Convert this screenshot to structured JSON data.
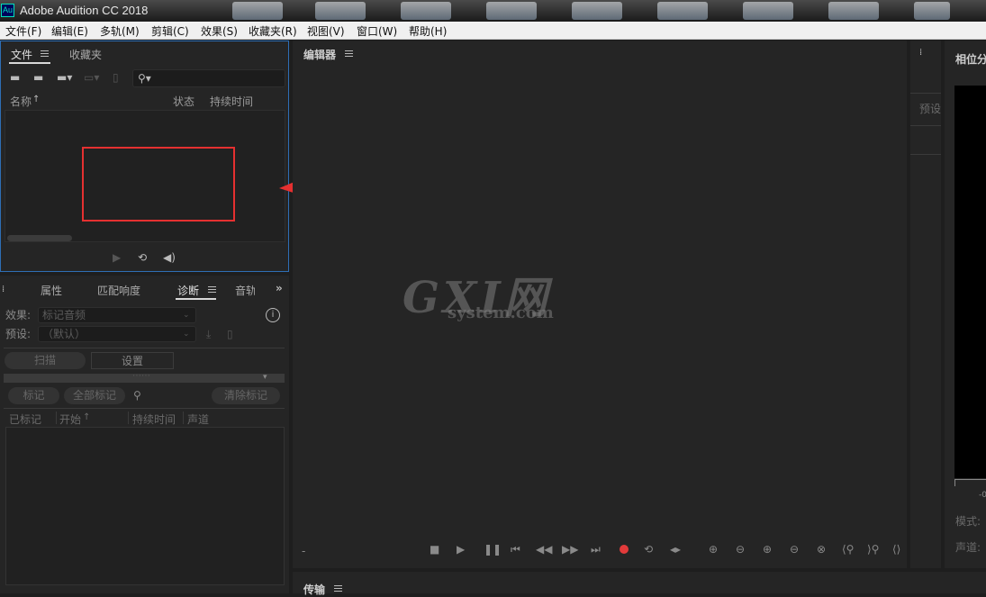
{
  "titlebar": {
    "app_icon": "Au",
    "title": "Adobe Audition CC 2018"
  },
  "menu": [
    "文件(F)",
    "编辑(E)",
    "多轨(M)",
    "剪辑(C)",
    "效果(S)",
    "收藏夹(R)",
    "视图(V)",
    "窗口(W)",
    "帮助(H)"
  ],
  "files_panel": {
    "tabs": [
      "文件",
      "收藏夹"
    ],
    "search_placeholder": "",
    "columns": [
      "名称",
      "状态",
      "持续时间"
    ],
    "sort_icon": "arrow-up-icon",
    "items": []
  },
  "diag_panel": {
    "tabs": [
      "属性",
      "匹配响度",
      "诊断",
      "音轨"
    ],
    "effect_label": "效果:",
    "effect_value": "标记音频",
    "preset_label": "预设:",
    "preset_value": "（默认）",
    "scan_btn": "扫描",
    "settings_btn": "设置",
    "mark_btn": "标记",
    "mark_all_btn": "全部标记",
    "clear_marks_btn": "清除标记",
    "columns": [
      "已标记",
      "开始",
      "持续时间",
      "声道"
    ]
  },
  "editor": {
    "title": "编辑器",
    "bottom_marker": "-"
  },
  "transport": {
    "title": "传输"
  },
  "side_panel": {
    "preset_label": "预设"
  },
  "right_panel": {
    "title": "相位分",
    "tick_label": "-0",
    "mode_label": "模式:",
    "channel_label": "声道:"
  },
  "watermark": {
    "big": "GXI网",
    "small": "system.com"
  },
  "annotation": {
    "color": "#e53030"
  },
  "colors": {
    "record": "#e23a3a",
    "accent_border": "#2e6eb5"
  }
}
